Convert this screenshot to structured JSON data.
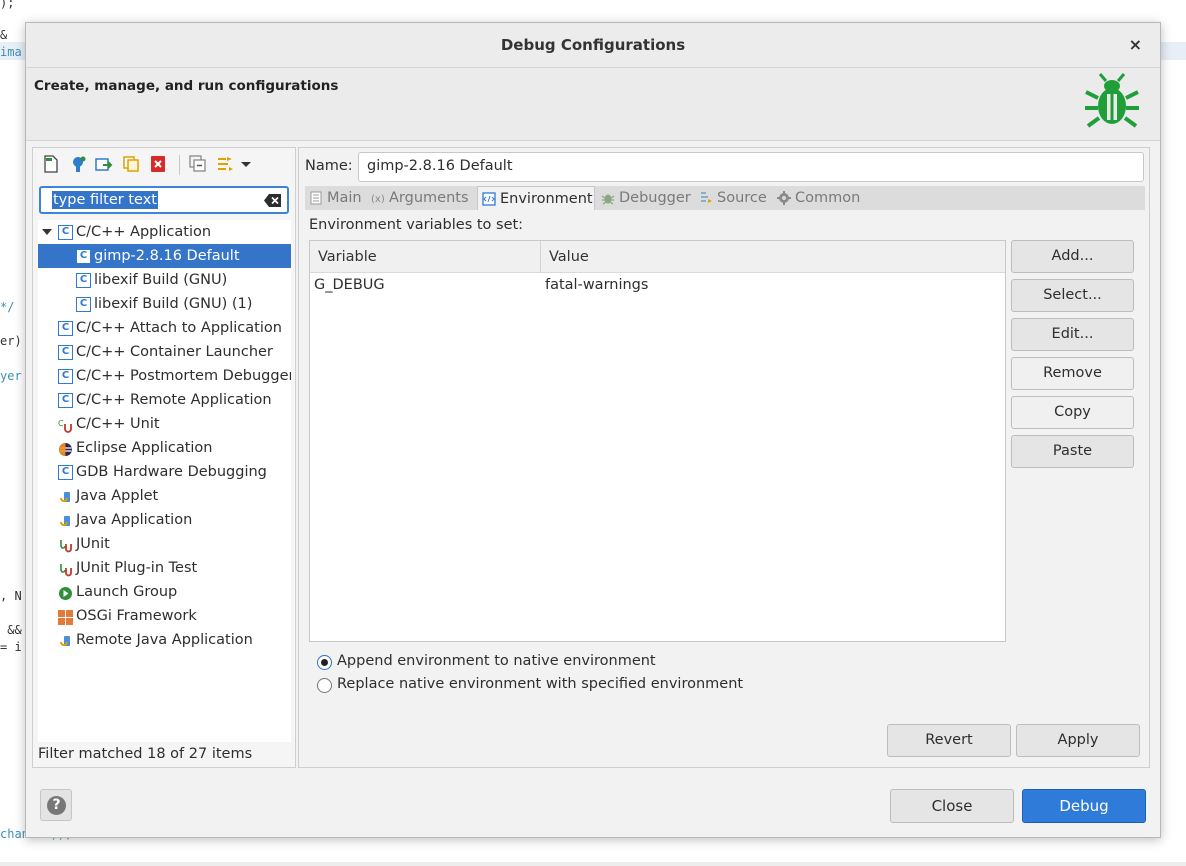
{
  "background": {
    "lines": [
      {
        "text": ");",
        "cls": ""
      },
      {
        "text": "&",
        "cls": ""
      },
      {
        "text": "ima",
        "cls": "cyan"
      },
      {
        "text": "*/",
        "cls": "cyan"
      },
      {
        "text": "er)",
        "cls": ""
      },
      {
        "text": "yer",
        "cls": "cyan"
      },
      {
        "text": ", N",
        "cls": ""
      },
      {
        "text": " &&",
        "cls": ""
      },
      {
        "text": "= i",
        "cls": ""
      },
      {
        "text": "channel));",
        "cls": "cyan"
      }
    ]
  },
  "dialog": {
    "title": "Debug Configurations",
    "close_glyph": "×",
    "subtitle": "Create, manage, and run configurations"
  },
  "left": {
    "filter_placeholder": "type filter text",
    "status": "Filter matched 18 of 27 items",
    "tree": [
      {
        "label": "C/C++ Application",
        "icon": "c-config-icon",
        "level": 0,
        "expanded": true,
        "selected": false
      },
      {
        "label": "gimp-2.8.16 Default",
        "icon": "c-config-icon",
        "level": 1,
        "selected": true
      },
      {
        "label": "libexif Build (GNU)",
        "icon": "c-config-icon",
        "level": 1,
        "selected": false
      },
      {
        "label": "libexif Build (GNU) (1)",
        "icon": "c-config-icon",
        "level": 1,
        "selected": false
      },
      {
        "label": "C/C++ Attach to Application",
        "icon": "c-config-icon",
        "level": 0,
        "selected": false
      },
      {
        "label": "C/C++ Container Launcher",
        "icon": "c-config-icon",
        "level": 0,
        "selected": false
      },
      {
        "label": "C/C++ Postmortem Debugger",
        "icon": "c-config-icon",
        "level": 0,
        "selected": false
      },
      {
        "label": "C/C++ Remote Application",
        "icon": "c-config-icon",
        "level": 0,
        "selected": false
      },
      {
        "label": "C/C++ Unit",
        "icon": "cunit-icon",
        "level": 0,
        "selected": false
      },
      {
        "label": "Eclipse Application",
        "icon": "eclipse-icon",
        "level": 0,
        "selected": false
      },
      {
        "label": "GDB Hardware Debugging",
        "icon": "c-config-icon",
        "level": 0,
        "selected": false
      },
      {
        "label": "Java Applet",
        "icon": "java-icon",
        "level": 0,
        "selected": false
      },
      {
        "label": "Java Application",
        "icon": "java-icon",
        "level": 0,
        "selected": false
      },
      {
        "label": "JUnit",
        "icon": "junit-icon",
        "level": 0,
        "selected": false
      },
      {
        "label": "JUnit Plug-in Test",
        "icon": "junit-icon",
        "level": 0,
        "selected": false
      },
      {
        "label": "Launch Group",
        "icon": "launch-group-icon",
        "level": 0,
        "selected": false
      },
      {
        "label": "OSGi Framework",
        "icon": "osgi-icon",
        "level": 0,
        "selected": false
      },
      {
        "label": "Remote Java Application",
        "icon": "java-icon",
        "level": 0,
        "selected": false
      }
    ]
  },
  "right": {
    "name_label": "Name:",
    "name_value": "gimp-2.8.16 Default",
    "tabs": [
      {
        "label": "Main",
        "icon": "main-tab-icon",
        "active": false
      },
      {
        "label": "Arguments",
        "icon": "arguments-tab-icon",
        "active": false
      },
      {
        "label": "Environment",
        "icon": "environment-tab-icon",
        "active": true
      },
      {
        "label": "Debugger",
        "icon": "debugger-tab-icon",
        "active": false
      },
      {
        "label": "Source",
        "icon": "source-tab-icon",
        "active": false
      },
      {
        "label": "Common",
        "icon": "common-tab-icon",
        "active": false
      }
    ],
    "env_label": "Environment variables to set:",
    "columns": {
      "variable": "Variable",
      "value": "Value"
    },
    "rows": [
      {
        "variable": "G_DEBUG",
        "value": "fatal-warnings"
      }
    ],
    "side_buttons": [
      "Add...",
      "Select...",
      "Edit...",
      "Remove",
      "Copy",
      "Paste"
    ],
    "radio": {
      "append": "Append environment to native environment",
      "replace": "Replace native environment with specified environment",
      "selected": "append"
    },
    "revert": "Revert",
    "apply": "Apply"
  },
  "footer": {
    "help_glyph": "?",
    "close": "Close",
    "debug": "Debug"
  },
  "colors": {
    "accent": "#3474c9",
    "bug_green": "#1f9e3a",
    "debug_button": "#2f7bd9"
  }
}
